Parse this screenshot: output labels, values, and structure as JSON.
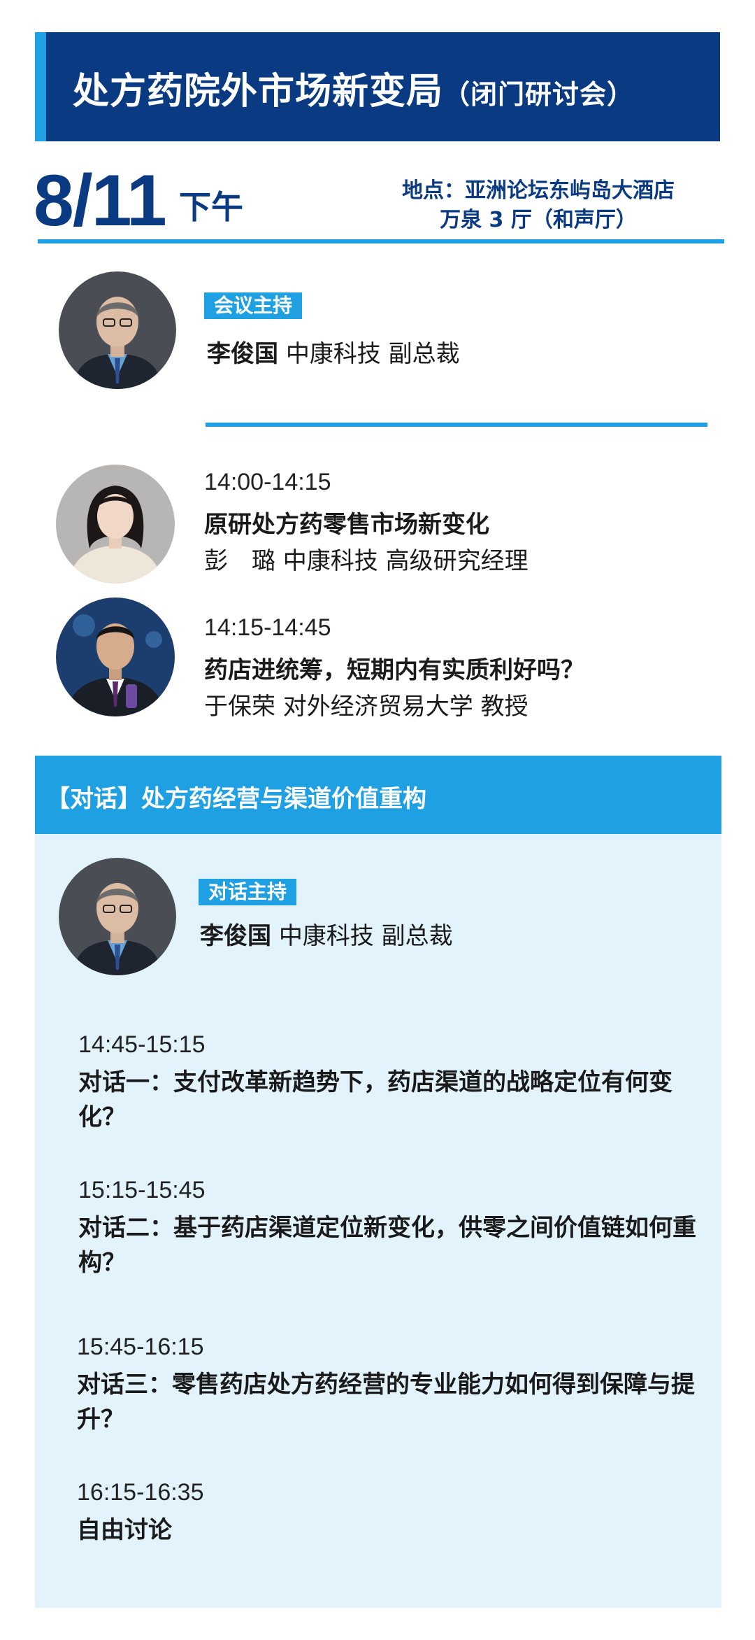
{
  "header": {
    "title": "处方药院外市场新变局",
    "subtitle": "（闭门研讨会）"
  },
  "session": {
    "date": "8/11",
    "period": "下午",
    "venue_line1": "地点：亚洲论坛东屿岛大酒店",
    "venue_line2": "万泉 3 厅（和声厅）"
  },
  "host": {
    "tag": "会议主持",
    "name": "李俊国",
    "org_title": "中康科技 副总裁"
  },
  "talks": [
    {
      "time": "14:00-14:15",
      "title": "原研处方药零售市场新变化",
      "speaker": "彭　璐 中康科技 高级研究经理"
    },
    {
      "time": "14:15-14:45",
      "title": "药店进统筹，短期内有实质利好吗？",
      "speaker": "于保荣 对外经济贸易大学 教授"
    }
  ],
  "dialogue": {
    "heading": "【对话】处方药经营与渠道价值重构",
    "host_tag": "对话主持",
    "host_name": "李俊国",
    "host_org_title": "中康科技 副总裁",
    "items": [
      {
        "time": "14:45-15:15",
        "title": "对话一：支付改革新趋势下，药店渠道的战略定位有何变化？"
      },
      {
        "time": "15:15-15:45",
        "title": "对话二：基于药店渠道定位新变化，供零之间价值链如何重构？"
      },
      {
        "time": "15:45-16:15",
        "title": "对话三：零售药店处方药经营的专业能力如何得到保障与提升？"
      },
      {
        "time": "16:15-16:35",
        "title": "自由讨论"
      }
    ]
  },
  "colors": {
    "navy": "#0a3a82",
    "accent_blue": "#1fa0e3",
    "panel_bg": "#e3f3fc"
  }
}
